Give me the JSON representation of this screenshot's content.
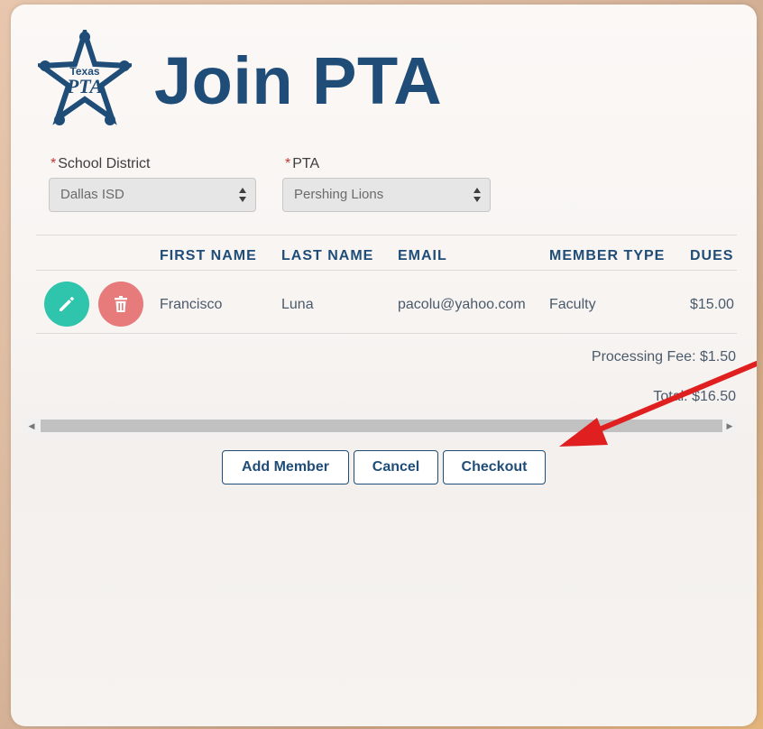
{
  "header": {
    "logo_top_text": "Texas",
    "logo_main_text": "PTA",
    "title": "Join PTA"
  },
  "form": {
    "required_marker": "*",
    "district_label": "School District",
    "district_value": "Dallas ISD",
    "pta_label": "PTA",
    "pta_value": "Pershing Lions"
  },
  "table": {
    "columns": [
      "FIRST NAME",
      "LAST NAME",
      "EMAIL",
      "MEMBER TYPE",
      "DUES"
    ],
    "rows": [
      {
        "first_name": "Francisco",
        "last_name": "Luna",
        "email": "pacolu@yahoo.com",
        "member_type": "Faculty",
        "dues": "$15.00"
      }
    ]
  },
  "summary": {
    "processing_fee": "Processing Fee: $1.50",
    "total": "Total: $16.50"
  },
  "actions": {
    "add_member": "Add Member",
    "cancel": "Cancel",
    "checkout": "Checkout"
  },
  "colors": {
    "brand_blue": "#1f4d78",
    "edit_green": "#2fc5ac",
    "delete_red": "#e77a7a",
    "annotation_arrow": "#e02020"
  },
  "icons": {
    "edit": "pencil-icon",
    "delete": "trash-icon",
    "logo": "texas-pta-star-logo"
  }
}
